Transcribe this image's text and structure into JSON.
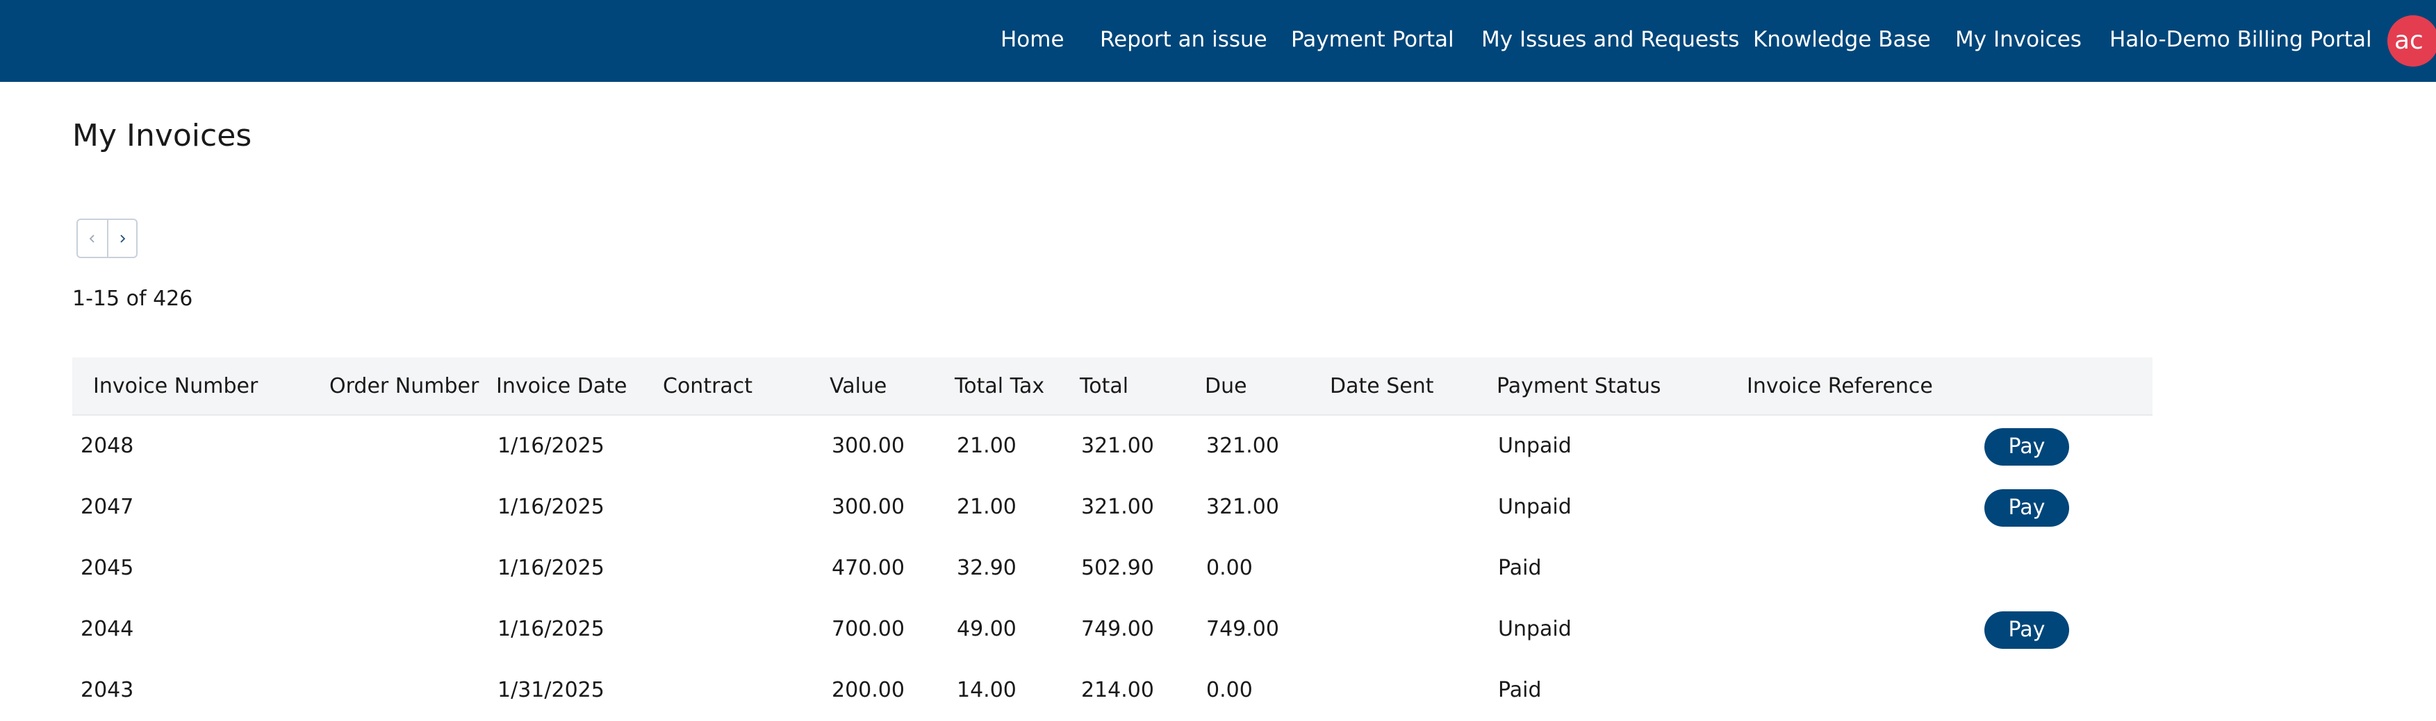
{
  "nav": {
    "items": [
      "Home",
      "Report an issue",
      "Payment Portal",
      "My Issues and Requests",
      "Knowledge Base",
      "My Invoices",
      "Halo-Demo Billing Portal"
    ],
    "avatar_initials": "ac"
  },
  "page": {
    "title": "My Invoices",
    "range_label": "1-15 of 426"
  },
  "colors": {
    "header_bg": "#00467a",
    "avatar_bg": "#e43d50",
    "pay_button_bg": "#00467a",
    "table_header_bg": "#f4f5f7"
  },
  "icons": {
    "pager_prev": "chevron-left-icon",
    "pager_next": "chevron-right-icon"
  },
  "table": {
    "columns": [
      "Invoice Number",
      "Order Number",
      "Invoice Date",
      "Contract",
      "Value",
      "Total Tax",
      "Total",
      "Due",
      "Date Sent",
      "Payment Status",
      "Invoice Reference"
    ],
    "rows": [
      {
        "invoice_number": "2048",
        "order_number": "",
        "invoice_date": "1/16/2025",
        "contract": "",
        "value": "300.00",
        "total_tax": "21.00",
        "total": "321.00",
        "due": "321.00",
        "date_sent": "",
        "payment_status": "Unpaid",
        "invoice_reference": "",
        "pay_label": "Pay"
      },
      {
        "invoice_number": "2047",
        "order_number": "",
        "invoice_date": "1/16/2025",
        "contract": "",
        "value": "300.00",
        "total_tax": "21.00",
        "total": "321.00",
        "due": "321.00",
        "date_sent": "",
        "payment_status": "Unpaid",
        "invoice_reference": "",
        "pay_label": "Pay"
      },
      {
        "invoice_number": "2045",
        "order_number": "",
        "invoice_date": "1/16/2025",
        "contract": "",
        "value": "470.00",
        "total_tax": "32.90",
        "total": "502.90",
        "due": "0.00",
        "date_sent": "",
        "payment_status": "Paid",
        "invoice_reference": "",
        "pay_label": ""
      },
      {
        "invoice_number": "2044",
        "order_number": "",
        "invoice_date": "1/16/2025",
        "contract": "",
        "value": "700.00",
        "total_tax": "49.00",
        "total": "749.00",
        "due": "749.00",
        "date_sent": "",
        "payment_status": "Unpaid",
        "invoice_reference": "",
        "pay_label": "Pay"
      },
      {
        "invoice_number": "2043",
        "order_number": "",
        "invoice_date": "1/31/2025",
        "contract": "",
        "value": "200.00",
        "total_tax": "14.00",
        "total": "214.00",
        "due": "0.00",
        "date_sent": "",
        "payment_status": "Paid",
        "invoice_reference": "",
        "pay_label": ""
      }
    ]
  }
}
